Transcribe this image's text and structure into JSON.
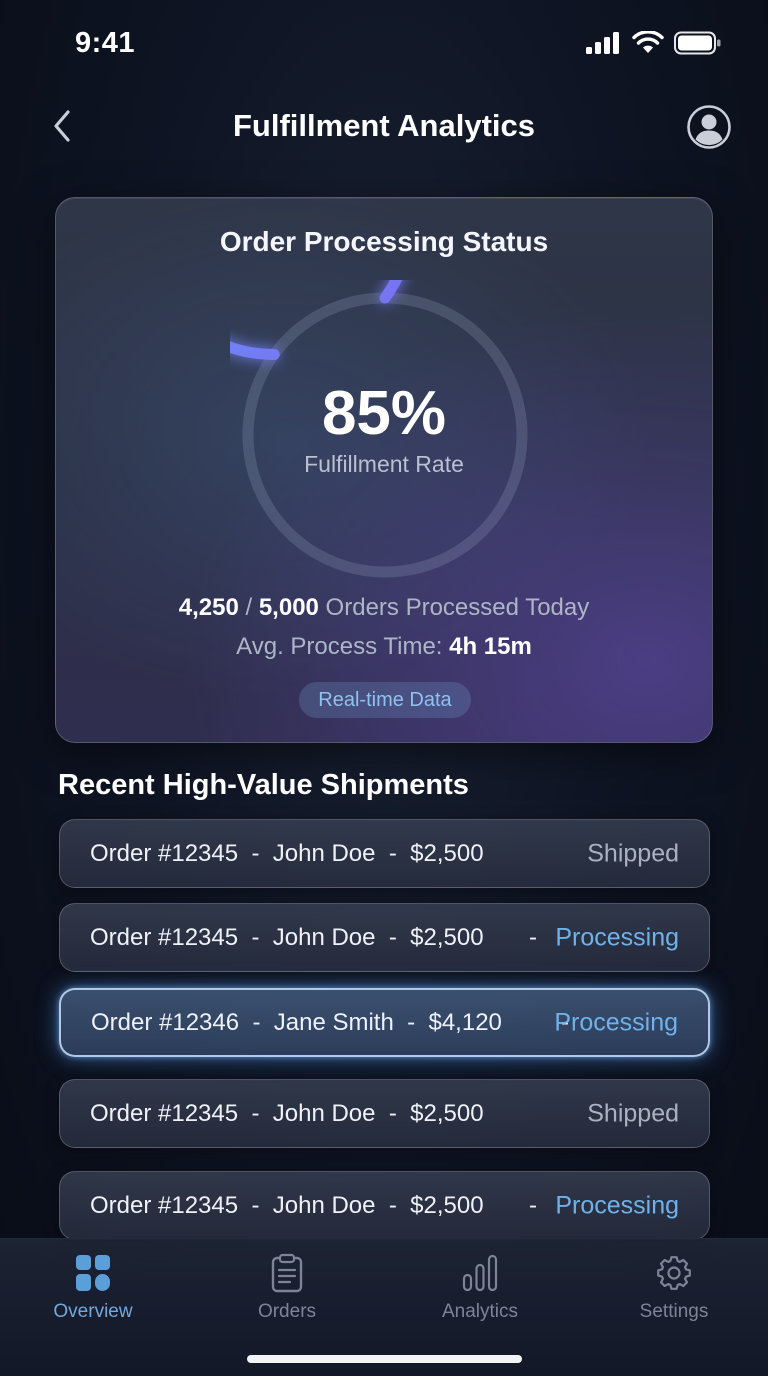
{
  "status_bar": {
    "time": "9:41"
  },
  "header": {
    "title": "Fulfillment Analytics"
  },
  "status_card": {
    "title": "Order Processing Status",
    "fulfillment_rate_text": "85%",
    "fulfillment_rate": 0.85,
    "rate_label": "Fulfillment Rate",
    "processed": "4,250",
    "divider": " / ",
    "total": "5,000",
    "orders_suffix": " Orders Processed Today",
    "avg_label": "Avg. Process Time: ",
    "avg_value": "4h 15m",
    "badge": "Real-time Data"
  },
  "shipments": {
    "title": "Recent High-Value Shipments",
    "separator": "-",
    "rows": [
      {
        "text": "Order #12345  -  John Doe  -  $2,500",
        "status": "Shipped",
        "show_separator": false
      },
      {
        "text": "Order #12345  -  John Doe  -  $2,500",
        "status": "Processing",
        "show_separator": true
      },
      {
        "text": "Order #12346  -  Jane Smith  -  $4,120",
        "status": "Processing",
        "show_separator": true
      },
      {
        "text": "Order #12345  -  John Doe  -  $2,500",
        "status": "Shipped",
        "show_separator": false
      },
      {
        "text": "Order #12345  -  John Doe  -  $2,500",
        "status": "Processing",
        "show_separator": true
      }
    ]
  },
  "tabs": [
    {
      "label": "Overview",
      "icon": "grid-icon",
      "active": true
    },
    {
      "label": "Orders",
      "icon": "clipboard-icon",
      "active": false
    },
    {
      "label": "Analytics",
      "icon": "bar-chart-icon",
      "active": false
    },
    {
      "label": "Settings",
      "icon": "gear-icon",
      "active": false
    }
  ],
  "colors": {
    "accent": "#6fb2ea",
    "ring_start": "#5ab6ff",
    "ring_end": "#7b6cf0",
    "shipped": "#aab1bf",
    "processing": "#6fb2ea"
  }
}
